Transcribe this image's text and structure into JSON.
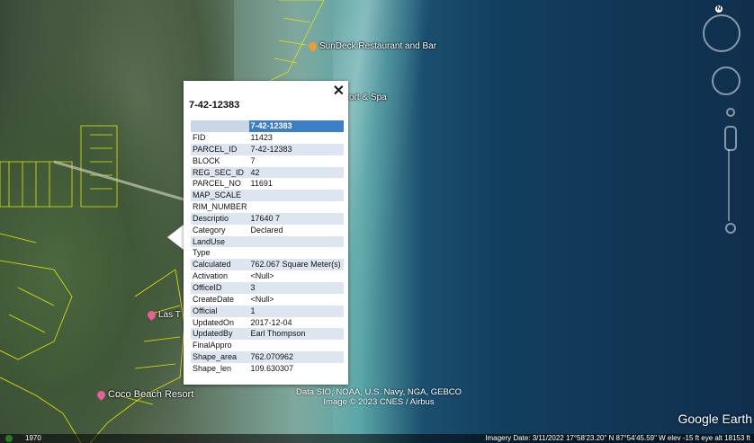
{
  "map": {
    "labels": {
      "sundeck": "SunDeck Restaurant and Bar",
      "resort_spa": "ort & Spa",
      "las": "Las T",
      "coco": "Coco Beach Resort"
    },
    "credits": [
      "Data SIO, NOAA, U.S. Navy, NGA, GEBCO",
      "Image © 2023 CNES / Airbus"
    ],
    "logo": "Google Earth",
    "compass_letter": "N"
  },
  "popup": {
    "title": "7-42-12383",
    "close_label": "✕",
    "header": "7-42-12383",
    "rows": [
      {
        "key": "FID",
        "value": "11423"
      },
      {
        "key": "PARCEL_ID",
        "value": "7-42-12383"
      },
      {
        "key": "BLOCK",
        "value": "7"
      },
      {
        "key": "REG_SEC_ID",
        "value": "42"
      },
      {
        "key": "PARCEL_NO",
        "value": "11691"
      },
      {
        "key": "MAP_SCALE",
        "value": ""
      },
      {
        "key": "RIM_NUMBER",
        "value": ""
      },
      {
        "key": "Descriptio",
        "value": "17640 7"
      },
      {
        "key": "Category",
        "value": "Declared"
      },
      {
        "key": "LandUse",
        "value": ""
      },
      {
        "key": "Type",
        "value": ""
      },
      {
        "key": "Calculated",
        "value": "762.067 Square Meter(s)"
      },
      {
        "key": "Activation",
        "value": "<Null>"
      },
      {
        "key": "OfficeID",
        "value": "3"
      },
      {
        "key": "CreateDate",
        "value": "<Null>"
      },
      {
        "key": "Official",
        "value": "1"
      },
      {
        "key": "UpdatedOn",
        "value": "2017-12-04"
      },
      {
        "key": "UpdatedBy",
        "value": "Earl Thompson"
      },
      {
        "key": "FinalAppro",
        "value": ""
      },
      {
        "key": "Shape_area",
        "value": "762.070962"
      },
      {
        "key": "Shape_len",
        "value": "109.630307"
      }
    ]
  },
  "statusbar": {
    "year": "1970",
    "info": "Imagery Date: 3/11/2022    17°58'23.20\" N   87°54'45.59\" W   elev  -15 ft    eye alt  18153 ft"
  }
}
